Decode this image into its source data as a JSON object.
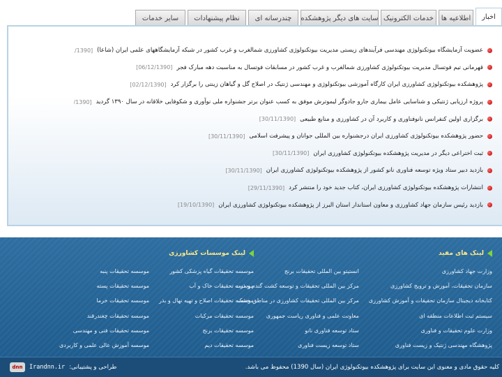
{
  "tabs": [
    {
      "id": "news",
      "label": "اخبار"
    },
    {
      "id": "announcements",
      "label": "اطلاعیه ها"
    },
    {
      "id": "e-services",
      "label": "خدمات الکترونیک"
    },
    {
      "id": "other-sites",
      "label": "سایت های دیگر پژوهشکده"
    },
    {
      "id": "multimedia",
      "label": "چندرسانه ای"
    },
    {
      "id": "suggestions",
      "label": "نظام پیشنهادات"
    },
    {
      "id": "other-services",
      "label": "سایر خدمات"
    }
  ],
  "news": [
    {
      "title": "عضویت آزمایشگاه بیوتکنولوژی مهندسی فرآیندهای زیستی مدیریت بیوتکنولوژی کشاورزی شمالغرب و غرب کشور در شبکه آزمایشگاههای علمی ایران (شاعا)",
      "date": "[10/12/1390]"
    },
    {
      "title": "قهرمانی تیم فوتسال مدیریت بیوتکنولوژی کشاورزی شمالغرب و غرب کشور در مسابقات فوتسال به مناسبت دهه مبارک فجر",
      "date": "[06/12/1390]"
    },
    {
      "title": "پژوهشکده بیوتکنولوژی کشاورزی ایران کارگاه آموزشی بیوتکنولوژی و مهندسی ژنتیک در اصلاح گل و گیاهان زینتی را برگزار کرد",
      "date": "[02/12/1390]"
    },
    {
      "title": "پروژه ارزیابی ژنتیکی و شناسایی عامل بیماری جارو جادوگر لیموترش موفق به کسب عنوان برتر جشنواره ملی نوآوری و شکوفایی خلاقانه در سال ۱۳۹۰ گردید",
      "date": "[30/11/1390]"
    },
    {
      "title": "برگزاری اولین کنفرانس نانوفناوری و کاربرد آن در کشاورزی و منابع طبیعی",
      "date": "[30/11/1390]"
    },
    {
      "title": "حضور پژوهشکده بیوتکنولوژی کشاورزی ایران درجشنواره بین المللی جوانان و پیشرفت اسلامی",
      "date": "[30/11/1390]"
    },
    {
      "title": "ثبت اختراعی دیگر در مدیریت پژوهشکده بیوتکنولوژی کشاورزی ایران",
      "date": "[30/11/1390]"
    },
    {
      "title": "بازدید دبیر ستاد ویژه توسعه فناوری نانو کشور از پژوهشکده بیوتکنولوژی کشاورزی ایران",
      "date": "[30/11/1390]"
    },
    {
      "title": "انتشارات پژوهشکده بیوتکنولوژی کشاورزی ایران، کتاب جدید خود را منتشر کرد",
      "date": "[29/11/1390]"
    },
    {
      "title": "بازدید رئیس سازمان جهاد کشاورزی و معاون استاندار استان البرز از پژوهشکده بیوتکنولوژی کشاورزی ایران",
      "date": "[19/10/1390]"
    }
  ],
  "footer": {
    "useful_links": {
      "heading": "لینک های مفید",
      "col1": [
        "وزارت جهاد کشاورزی",
        "سازمان تحقیقات، آموزش و ترویج کشاورزی",
        "کتابخانه دیجیتال سازمان تحقیقات و آموزش کشاورزی",
        "سیستم ثبت اطلاعات منطقه ای",
        "وزارت علوم تحقیقات و فناوری",
        "پژوهشگاه مهندسی ژنتیک و زیست فناوری"
      ],
      "col2": [
        "انستیتو بین المللی تحقیقات برنج",
        "مرکز بین المللی تحقیقات و توسعه کشت گندم و ذرت",
        "مرکز بین المللی تحقیقات کشاورزی در مناطق خشک",
        "معاونت علمی و فناوری ریاست جمهوری",
        "ستاد توسعه فناوری نانو",
        "ستاد توسعه زیست فناوری"
      ]
    },
    "institutes": {
      "heading": "لینک موسسات کشاورزی",
      "col1": [
        "موسسه تحقیقات گیاه پزشکی کشور",
        "موسسه تحقیقات خاک و آب",
        "موسسه تحقیقات اصلاح و تهیه نهال و بذر",
        "موسسه تحقیقات مرکبات",
        "موسسه تحقیقات برنج",
        "موسسه تحقیقات دیم"
      ],
      "col2": [
        "موسسه تحقیقات پنبه",
        "موسسه تحقیقات پسته",
        "موسسه تحقیقات خرما",
        "موسسه تحقیقات چغندرقند",
        "موسسه تحقیقات فنی و مهندسی",
        "موسسه آموزش عالی علمی و کاربردی"
      ]
    },
    "copyright": "کلیه حقوق مادی و معنوی این سایت برای پژوهشکده بیوتکنولوژی ایران (سال 1390) محفوظ می باشد.",
    "designer_label": "طراحی و پشتیبانی:",
    "designer_site": "Irandnn.ir",
    "designer_logo": "dnn"
  }
}
